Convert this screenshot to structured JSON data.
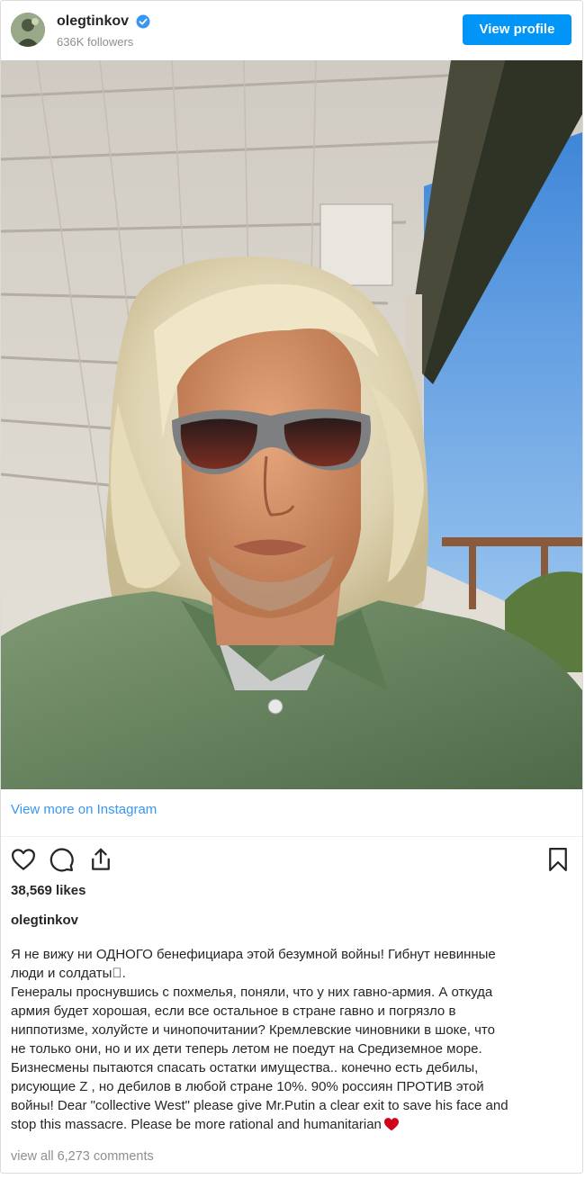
{
  "header": {
    "username": "olegtinkov",
    "followers": "636K followers",
    "view_profile_label": "View profile"
  },
  "post": {
    "image_alt": "Selfie of a man with long light hair and dark sunglasses under a wooden canopy",
    "view_more_label": "View more on Instagram",
    "likes": "38,569 likes",
    "caption_user": "olegtinkov",
    "caption_text": "Я не вижу ни ОДНОГО бенефициара этой безумной войны! Гибнут невинные\nлюди и солдаты⃞.\nГенералы проснувшись с похмелья, поняли, что у них гавно-армия. А откуда\nармия будет хорошая, если все остальное в стране гавно и погрязло в\nниппотизме, холуйсте и чинопочитании? Кремлевские чиновники в шоке, что\nне только они, но и их дети теперь летом не поедут на Средиземное море.\nБизнесмены пытаются спасать остатки имущества.. конечно есть дебилы,\nрисующие Z , но дебилов в любой стране 10%. 90% россиян ПРОТИВ этой\nвойны! Dear \"collective West\" please give Mr.Putin a clear exit to save his face and\nstop this massacre. Please be more rational and humanitarian",
    "comments_label": "view all 6,273 comments"
  },
  "icons": {
    "like": "heart-icon",
    "comment": "comment-icon",
    "share": "share-icon",
    "save": "bookmark-icon",
    "verified": "verified-badge-icon"
  },
  "colors": {
    "accent": "#0095f6",
    "link": "#3897f0",
    "muted": "#8e8e8e",
    "heart_emoji": "#d0021b"
  }
}
